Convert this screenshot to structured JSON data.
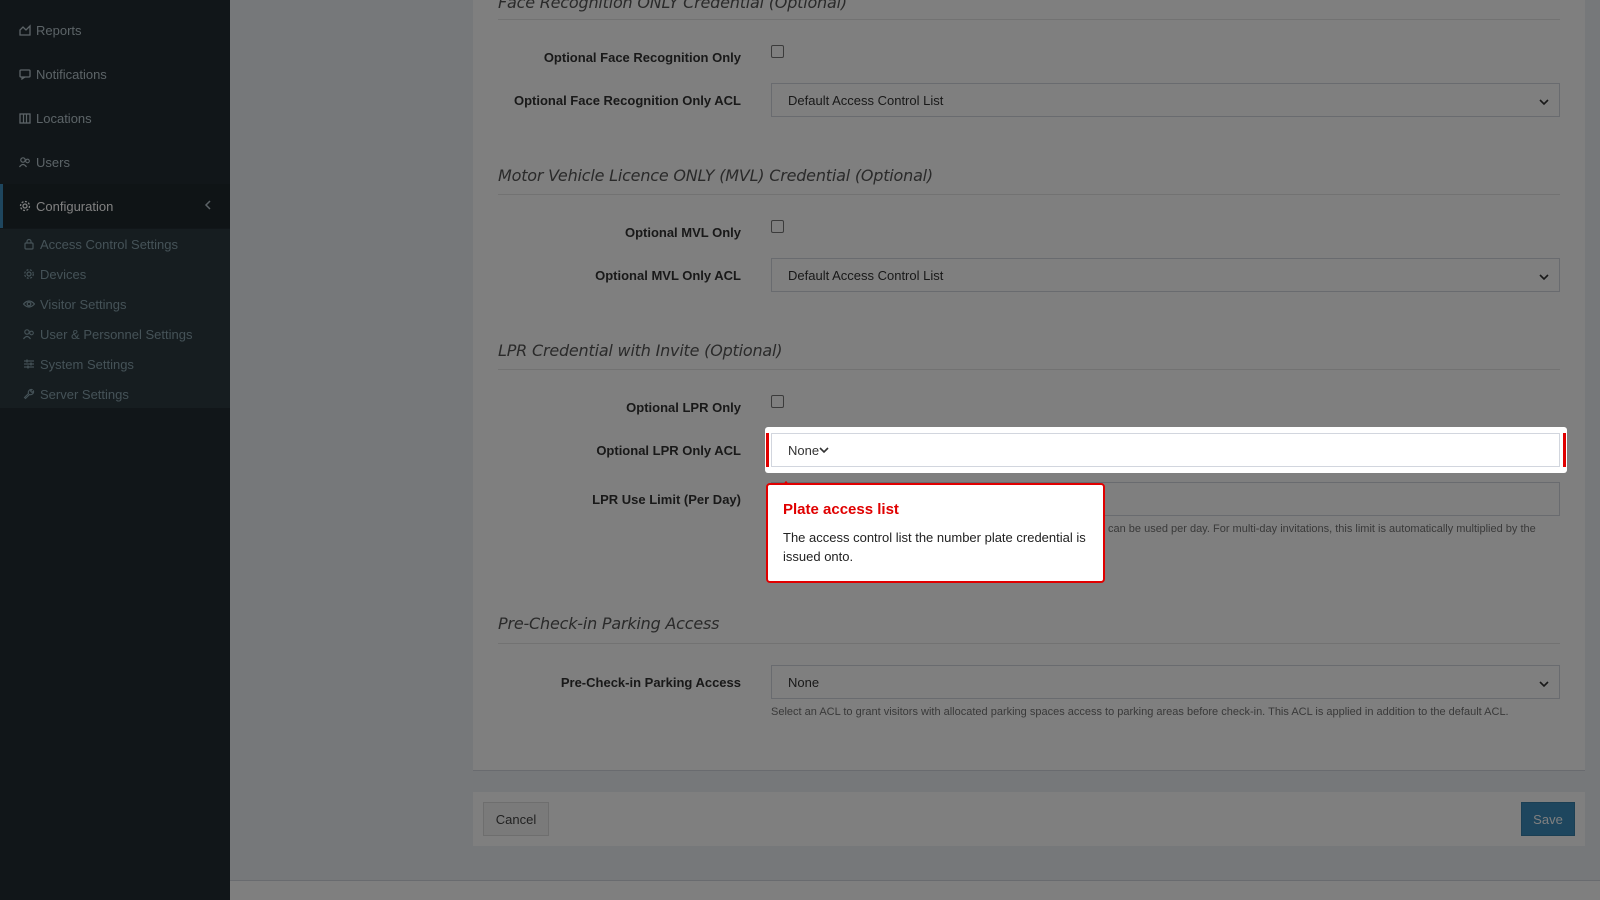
{
  "sidebar": {
    "items": [
      {
        "label": "Reports",
        "icon": "chart-icon"
      },
      {
        "label": "Notifications",
        "icon": "bell-icon"
      },
      {
        "label": "Locations",
        "icon": "building-icon"
      },
      {
        "label": "Users",
        "icon": "users-icon"
      },
      {
        "label": "Configuration",
        "icon": "gear-icon",
        "active": true
      }
    ],
    "submenu": [
      {
        "label": "Access Control Settings",
        "icon": "lock-icon"
      },
      {
        "label": "Devices",
        "icon": "gear-icon"
      },
      {
        "label": "Visitor Settings",
        "icon": "eye-icon"
      },
      {
        "label": "User & Personnel Settings",
        "icon": "users-icon"
      },
      {
        "label": "System Settings",
        "icon": "sliders-icon"
      },
      {
        "label": "Server Settings",
        "icon": "wrench-icon"
      }
    ]
  },
  "form": {
    "face": {
      "title": "Face Recognition ONLY Credential (Optional)",
      "only_label": "Optional Face Recognition Only",
      "acl_label": "Optional Face Recognition Only ACL",
      "acl_value": "Default Access Control List"
    },
    "mvl": {
      "title": "Motor Vehicle Licence ONLY (MVL) Credential (Optional)",
      "only_label": "Optional MVL Only",
      "acl_label": "Optional MVL Only ACL",
      "acl_value": "Default Access Control List"
    },
    "lpr": {
      "title": "LPR Credential with Invite (Optional)",
      "only_label": "Optional LPR Only",
      "acl_label": "Optional LPR Only ACL",
      "acl_value": "None",
      "limit_label": "LPR Use Limit (Per Day)",
      "limit_help": "can be used per day. For multi-day invitations, this limit is automatically multiplied by the"
    },
    "precheck": {
      "title": "Pre-Check-in Parking Access",
      "label": "Pre-Check-in Parking Access",
      "value": "None",
      "help": "Select an ACL to grant visitors with allocated parking spaces access to parking areas before check-in. This ACL is applied in addition to the default ACL."
    }
  },
  "actions": {
    "cancel_label": "Cancel",
    "save_label": "Save"
  },
  "tooltip": {
    "title": "Plate access list",
    "body": "The access control list the number plate credential is issued onto."
  },
  "colors": {
    "sidebar_bg": "#222d32",
    "accent": "#3c8dbc",
    "highlight_red": "#e00000"
  }
}
